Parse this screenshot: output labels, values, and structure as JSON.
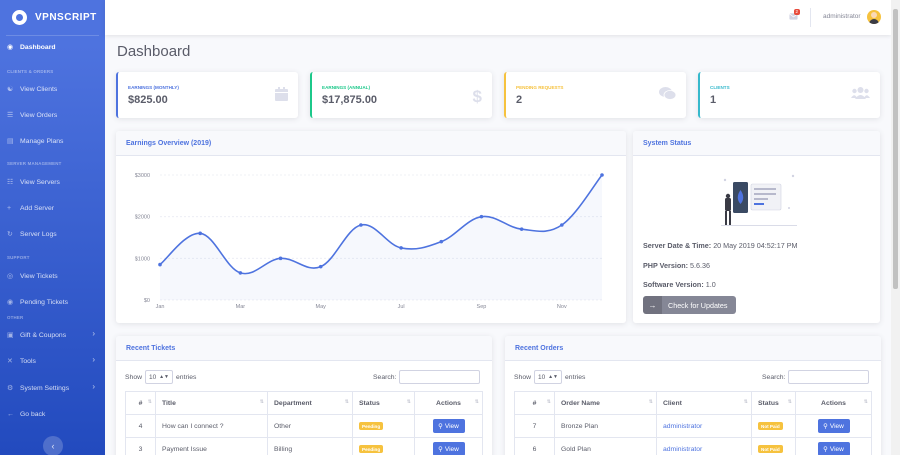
{
  "brand": {
    "name": "VPNSCRIPT"
  },
  "colors": {
    "primary": "#4e73df",
    "success": "#1cc88a",
    "warning": "#f6c23e",
    "info": "#36b9cc",
    "danger": "#e74a3b"
  },
  "sidebar": {
    "items": [
      {
        "label": "Dashboard",
        "icon": "dashboard-icon"
      },
      {
        "label": "View Clients",
        "icon": "users-icon"
      },
      {
        "label": "View Orders",
        "icon": "cart-icon"
      },
      {
        "label": "Manage Plans",
        "icon": "list-icon"
      },
      {
        "label": "View Servers",
        "icon": "server-icon"
      },
      {
        "label": "Add Server",
        "icon": "plus-icon"
      },
      {
        "label": "Server Logs",
        "icon": "history-icon"
      },
      {
        "label": "View Tickets",
        "icon": "ticket-icon"
      },
      {
        "label": "Pending Tickets",
        "icon": "pending-icon"
      },
      {
        "label": "Gift & Coupons",
        "icon": "gift-icon"
      },
      {
        "label": "Tools",
        "icon": "tools-icon"
      },
      {
        "label": "System Settings",
        "icon": "settings-icon"
      },
      {
        "label": "Go back",
        "icon": "arrow-left-icon"
      }
    ],
    "headings": {
      "clients": "CLIENTS & ORDERS",
      "servers": "SERVER MANAGEMENT",
      "support": "SUPPORT",
      "other": "OTHER"
    }
  },
  "topbar": {
    "notification_count": "2",
    "username": "administrator"
  },
  "page": {
    "title": "Dashboard"
  },
  "stats": [
    {
      "label": "EARNINGS (MONTHLY)",
      "value": "$825.00",
      "color": "#4e73df",
      "icon": "calendar-icon"
    },
    {
      "label": "EARNINGS (ANNUAL)",
      "value": "$17,875.00",
      "color": "#1cc88a",
      "icon": "dollar-icon"
    },
    {
      "label": "PENDING REQUESTS",
      "value": "2",
      "color": "#f6c23e",
      "icon": "comments-icon"
    },
    {
      "label": "CLIENTS",
      "value": "1",
      "color": "#36b9cc",
      "icon": "users-icon"
    }
  ],
  "earnings": {
    "title": "Earnings Overview (2019)"
  },
  "chart_data": {
    "type": "line",
    "title": "Earnings Overview (2019)",
    "x": [
      "Jan",
      "Feb",
      "Mar",
      "Apr",
      "May",
      "Jun",
      "Jul",
      "Aug",
      "Sep",
      "Oct",
      "Nov",
      "Dec"
    ],
    "x_tick_labels": [
      "Jan",
      "Mar",
      "May",
      "Jul",
      "Sep",
      "Nov"
    ],
    "y_tick_labels": [
      "$0",
      "$1000",
      "$2000",
      "$3000"
    ],
    "values": [
      850,
      1600,
      650,
      1000,
      800,
      1800,
      1250,
      1400,
      2000,
      1700,
      1800,
      3000
    ],
    "ylim": [
      0,
      3000
    ],
    "xlabel": "",
    "ylabel": "",
    "color": "#4e73df",
    "grid": true,
    "legend": "none"
  },
  "system": {
    "title": "System Status",
    "datetime_label": "Server Date & Time:",
    "datetime_value": "20 May 2019 04:52:17 PM",
    "php_label": "PHP Version:",
    "php_value": "5.6.36",
    "software_label": "Software Version:",
    "software_value": "1.0",
    "update_button": "Check for Updates"
  },
  "tickets": {
    "title": "Recent Tickets",
    "show": "Show",
    "entries": "entries",
    "length": "10",
    "search": "Search:",
    "columns": [
      "#",
      "Title",
      "Department",
      "Status",
      "Actions"
    ],
    "rows": [
      {
        "num": "4",
        "title": "How can I connect ?",
        "dept": "Other",
        "status": "Pending",
        "action": "View"
      },
      {
        "num": "3",
        "title": "Payment Issue",
        "dept": "Billing",
        "status": "Pending",
        "action": "View"
      }
    ]
  },
  "orders": {
    "title": "Recent Orders",
    "show": "Show",
    "entries": "entries",
    "length": "10",
    "search": "Search:",
    "columns": [
      "#",
      "Order Name",
      "Client",
      "Status",
      "Actions"
    ],
    "rows": [
      {
        "num": "7",
        "name": "Bronze Plan",
        "client": "administrator",
        "status": "Not Paid",
        "action": "View"
      },
      {
        "num": "6",
        "name": "Gold Plan",
        "client": "administrator",
        "status": "Not Paid",
        "action": "View"
      }
    ]
  }
}
